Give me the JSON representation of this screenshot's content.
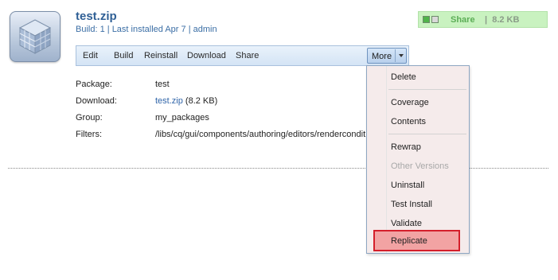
{
  "package": {
    "title": "test.zip",
    "build_label": "Build: 1",
    "separator": "|",
    "installed": "Last installed Apr 7",
    "user": "admin",
    "icon": "package-cube-icon"
  },
  "share_box": {
    "label": "Share",
    "separator": "|",
    "size": "8.2 KB",
    "colors": {
      "background": "#c9f2c0",
      "text": "#5cae56"
    }
  },
  "toolbar": {
    "edit": "Edit",
    "build": "Build",
    "reinstall": "Reinstall",
    "download": "Download",
    "share": "Share",
    "more": "More"
  },
  "info": {
    "package": {
      "label": "Package:",
      "value": "test"
    },
    "download": {
      "label": "Download:",
      "link": "test.zip",
      "size": "(8.2 KB)"
    },
    "group": {
      "label": "Group:",
      "value": "my_packages"
    },
    "filters": {
      "label": "Filters:",
      "value": "/libs/cq/gui/components/authoring/editors/rendercondit"
    }
  },
  "more_menu": {
    "items": [
      {
        "label": "Delete",
        "enabled": true
      },
      {
        "label": "Coverage",
        "enabled": true
      },
      {
        "label": "Contents",
        "enabled": true
      },
      {
        "label": "Rewrap",
        "enabled": true
      },
      {
        "label": "Other Versions",
        "enabled": false
      },
      {
        "label": "Uninstall",
        "enabled": true
      },
      {
        "label": "Test Install",
        "enabled": true
      },
      {
        "label": "Validate",
        "enabled": true
      },
      {
        "label": "Replicate",
        "enabled": true,
        "highlighted": true
      }
    ],
    "highlight_color": "#d41f2b"
  }
}
